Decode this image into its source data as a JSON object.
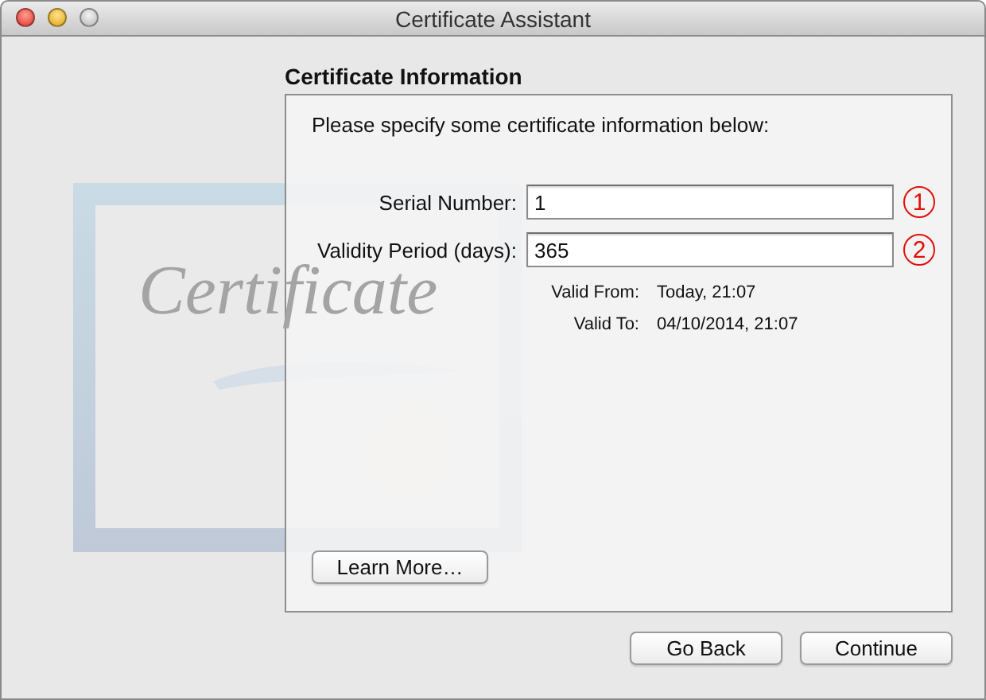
{
  "window": {
    "title": "Certificate Assistant",
    "controls": [
      {
        "kind": "close",
        "disabled": false
      },
      {
        "kind": "minimize",
        "disabled": false
      },
      {
        "kind": "zoom",
        "disabled": true
      }
    ]
  },
  "heading": "Certificate Information",
  "artwork": {
    "caption": "Certificate"
  },
  "panel": {
    "instruction": "Please specify some certificate information below:",
    "fields": [
      {
        "label": "Serial Number:",
        "value": "1",
        "callout": "1"
      },
      {
        "label": "Validity Period (days):",
        "value": "365",
        "callout": "2"
      }
    ],
    "validity": [
      {
        "label": "Valid From:",
        "value": "Today, 21:07"
      },
      {
        "label": "Valid To:",
        "value": "04/10/2014, 21:07"
      }
    ],
    "help_button": "Learn More…"
  },
  "buttons": [
    {
      "label": "Go Back"
    },
    {
      "label": "Continue"
    }
  ]
}
